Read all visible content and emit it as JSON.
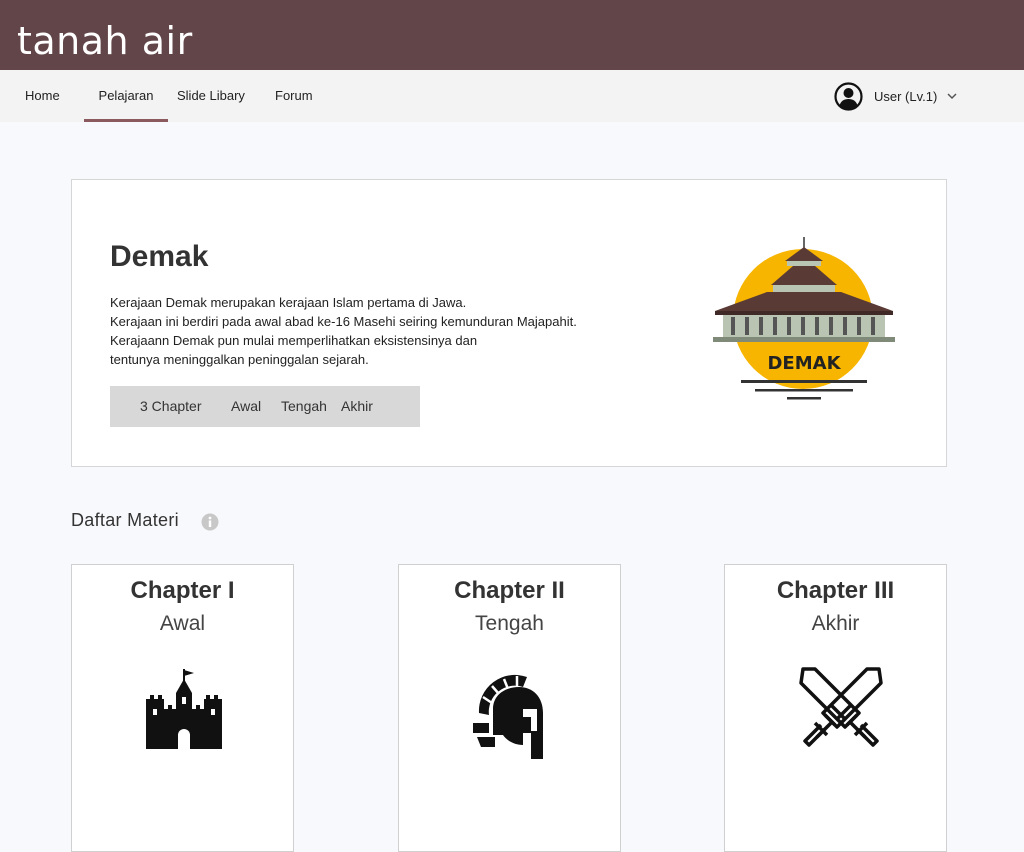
{
  "app": {
    "brand": "tanah air"
  },
  "nav": {
    "items": [
      {
        "label": "Home",
        "active": false
      },
      {
        "label": "Pelajaran",
        "active": true
      },
      {
        "label": "Slide Libary",
        "active": false
      },
      {
        "label": "Forum",
        "active": false
      }
    ],
    "user": {
      "label": "User (Lv.1)",
      "avatar_icon": "user-avatar-icon",
      "menu_icon": "chevron-down-icon"
    }
  },
  "hero": {
    "title": "Demak",
    "description_lines": [
      "Kerajaan Demak merupakan kerajaan Islam pertama di Jawa.",
      "Kerajaan ini berdiri pada awal abad ke-16 Masehi seiring kemunduran Majapahit.",
      "Kerajaann Demak pun mulai memperlihatkan eksistensinya dan",
      "tentunya meninggalkan peninggalan sejarah."
    ],
    "chapter_bar": {
      "count": "3 Chapter",
      "links": [
        "Awal",
        "Tengah",
        "Akhir"
      ]
    },
    "logo_text": "DEMAK",
    "colors": {
      "sun": "#f7b500",
      "roof": "#5a3a35",
      "wall": "#b9c4b3"
    }
  },
  "materials": {
    "title": "Daftar Materi",
    "info_icon": "info-icon",
    "chapters": [
      {
        "title": "Chapter I",
        "subtitle": "Awal",
        "icon": "castle-icon"
      },
      {
        "title": "Chapter II",
        "subtitle": "Tengah",
        "icon": "spartan-helmet-icon"
      },
      {
        "title": "Chapter III",
        "subtitle": "Akhir",
        "icon": "crossed-swords-icon"
      }
    ]
  },
  "colors": {
    "header_bg": "#614548",
    "nav_bg": "#f3f3f3",
    "active_underline": "#8a5a5e",
    "page_bg": "#f8f9fc"
  }
}
